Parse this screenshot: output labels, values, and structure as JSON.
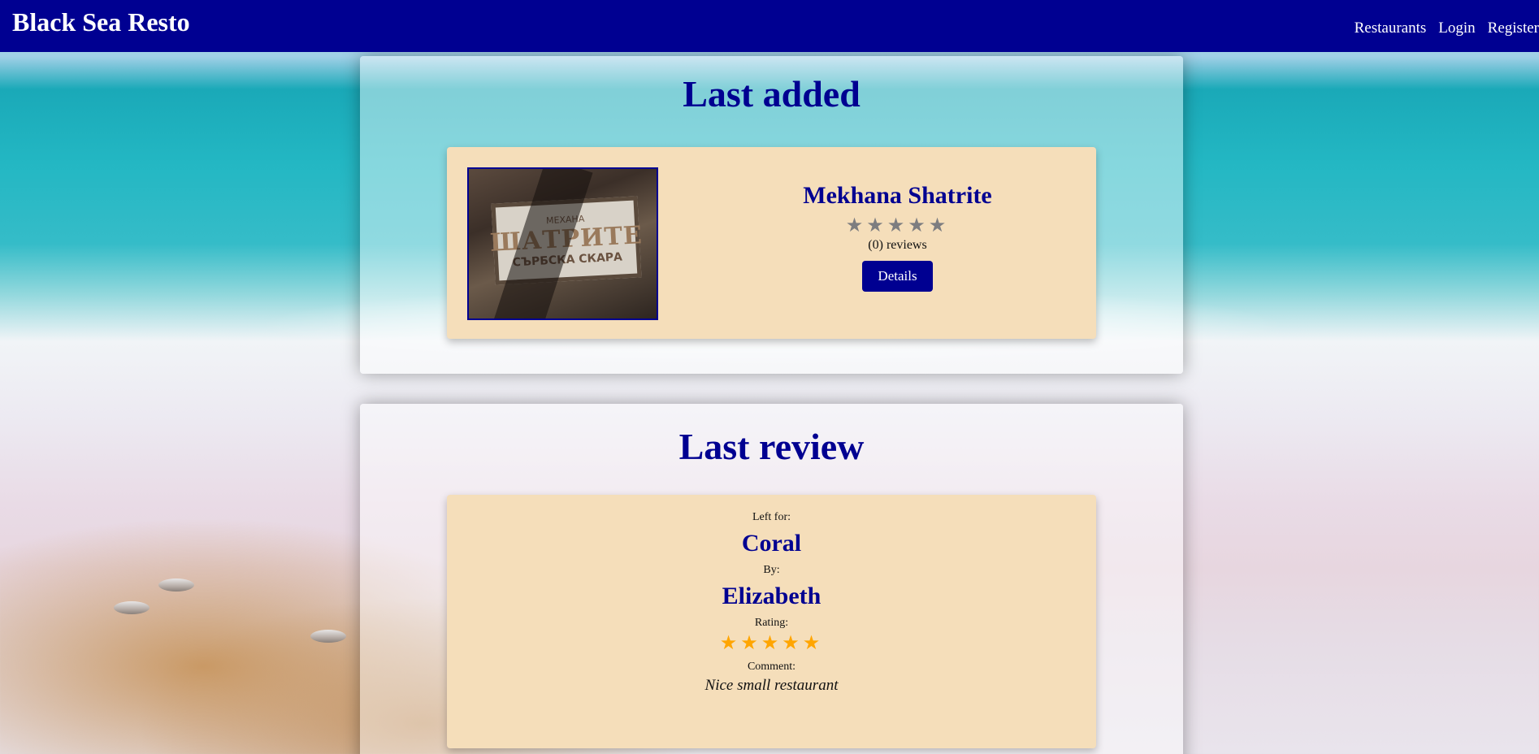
{
  "navbar": {
    "brand": "Black Sea Resto",
    "links": [
      "Restaurants",
      "Login",
      "Register"
    ]
  },
  "last_added": {
    "title": "Last added",
    "restaurant": {
      "name": "Mekhana Shatrite",
      "stars": "★★★★★",
      "rating": 0,
      "reviews_text": "(0) reviews",
      "details_label": "Details",
      "sign_text": [
        "МЕХАНА",
        "ШАТРИТЕ",
        "СЪРБСКА СКАРА"
      ]
    }
  },
  "last_review": {
    "title": "Last review",
    "left_for_label": "Left for:",
    "restaurant_name": "Coral",
    "by_label": "By:",
    "author": "Elizabeth",
    "rating_label": "Rating:",
    "stars": "★★★★★",
    "rating": 5,
    "comment_label": "Comment:",
    "comment": "Nice small restaurant"
  },
  "colors": {
    "navbar": "#000091",
    "card": "#f5deba",
    "accent": "#000091",
    "star_empty": "#7d7d80",
    "star_filled": "#ffa500"
  }
}
